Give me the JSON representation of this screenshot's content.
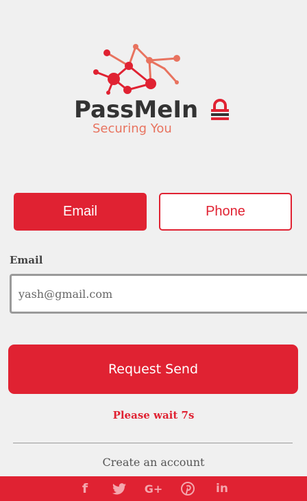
{
  "brand": {
    "name": "PassMeIn",
    "tagline": "Securing You"
  },
  "tabs": [
    {
      "label": "Email",
      "active": true
    },
    {
      "label": "Phone",
      "active": false
    }
  ],
  "email_field": {
    "label": "Email",
    "value": "",
    "placeholder": "yash@gmail.com"
  },
  "request_button": {
    "label": "Request Send"
  },
  "status": {
    "wait_text": "Please wait 7s"
  },
  "create_account": {
    "label": "Create an account"
  },
  "footer": {
    "social": [
      {
        "icon": "facebook-icon",
        "glyph": "f"
      },
      {
        "icon": "twitter-icon"
      },
      {
        "icon": "google-plus-icon",
        "glyph": "G+"
      },
      {
        "icon": "pinterest-icon"
      },
      {
        "icon": "linkedin-icon",
        "glyph": "in"
      }
    ]
  },
  "colors": {
    "accent": "#e02232",
    "background": "#f0f0f0",
    "tagline": "#e8735f"
  }
}
